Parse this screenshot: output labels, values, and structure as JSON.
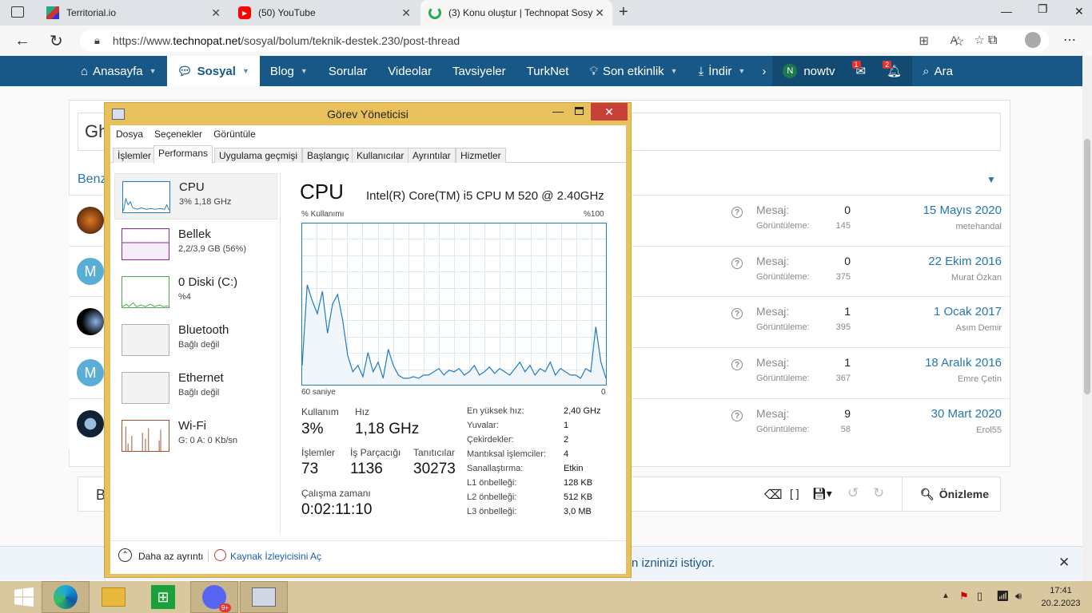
{
  "browser": {
    "tabs": [
      {
        "title": "Territorial.io"
      },
      {
        "title": "(50) YouTube"
      },
      {
        "title": "(3) Konu oluştur | Technopat Sosy"
      }
    ],
    "url_prefix": "https://www.",
    "url_domain": "technopat.net",
    "url_path": "/sosyal/bolum/teknik-destek.230/post-thread"
  },
  "nav": {
    "items": [
      {
        "label": "Anasayfa"
      },
      {
        "label": "Sosyal"
      },
      {
        "label": "Blog"
      },
      {
        "label": "Sorular"
      },
      {
        "label": "Videolar"
      },
      {
        "label": "Tavsiyeler"
      },
      {
        "label": "TurkNet"
      },
      {
        "label": "Son etkinlik"
      },
      {
        "label": "İndir"
      }
    ],
    "user": "nowtv",
    "user_initial": "N",
    "msg_badge": "1",
    "alert_badge": "2",
    "search": "Ara"
  },
  "page": {
    "title_fragment": "Gh",
    "similar_fragment": "Benz",
    "editor_fragment": "B",
    "preview_label": "Önizleme",
    "notice_text": "n izninizi istiyor.",
    "threads": [
      {
        "avatar": "",
        "mesaj_label": "Mesaj:",
        "goruntuleme_label": "Görüntüleme:",
        "mesaj": "0",
        "goruntuleme": "145",
        "date": "15 Mayıs 2020",
        "user": "metehandal"
      },
      {
        "avatar": "M",
        "mesaj_label": "Mesaj:",
        "goruntuleme_label": "Görüntüleme:",
        "mesaj": "0",
        "goruntuleme": "375",
        "date": "22 Ekim 2016",
        "user": "Murat Özkan"
      },
      {
        "avatar": "",
        "mesaj_label": "Mesaj:",
        "goruntuleme_label": "Görüntüleme:",
        "mesaj": "1",
        "goruntuleme": "395",
        "date": "1 Ocak 2017",
        "user": "Asım Demir"
      },
      {
        "avatar": "M",
        "mesaj_label": "Mesaj:",
        "goruntuleme_label": "Görüntüleme:",
        "mesaj": "1",
        "goruntuleme": "367",
        "date": "18 Aralık 2016",
        "user": "Emre Çetin"
      },
      {
        "avatar": "",
        "mesaj_label": "Mesaj:",
        "goruntuleme_label": "Görüntüleme:",
        "mesaj": "9",
        "goruntuleme": "58",
        "date": "30 Mart 2020",
        "user": "Erol55"
      }
    ]
  },
  "taskmgr": {
    "title": "Görev Yöneticisi",
    "menu": [
      "Dosya",
      "Seçenekler",
      "Görüntüle"
    ],
    "tabs": [
      "İşlemler",
      "Performans",
      "Uygulama geçmişi",
      "Başlangıç",
      "Kullanıcılar",
      "Ayrıntılar",
      "Hizmetler"
    ],
    "sidebar": [
      {
        "name": "CPU",
        "sub": "3%  1,18 GHz"
      },
      {
        "name": "Bellek",
        "sub": "2,2/3,9 GB (56%)"
      },
      {
        "name": "0 Diski (C:)",
        "sub": "%4"
      },
      {
        "name": "Bluetooth",
        "sub": "Bağlı değil"
      },
      {
        "name": "Ethernet",
        "sub": "Bağlı değil"
      },
      {
        "name": "Wi-Fi",
        "sub": "G: 0  A: 0 Kb/sn"
      }
    ],
    "heading": "CPU",
    "model": "Intel(R) Core(TM) i5 CPU M 520 @ 2.40GHz",
    "graph_label_left": "% Kullanımı",
    "graph_label_right": "%100",
    "graph_bottom_left": "60 saniye",
    "graph_bottom_right": "0",
    "stats": {
      "kullanim_label": "Kullanım",
      "kullanim": "3%",
      "hiz_label": "Hız",
      "hiz": "1,18 GHz",
      "islemler_label": "İşlemler",
      "islemler": "73",
      "parcacik_label": "İş Parçacığı",
      "parcacik": "1136",
      "tanitici_label": "Tanıtıcılar",
      "tanitici": "30273",
      "calisma_label": "Çalışma zamanı",
      "calisma": "0:02:11:10"
    },
    "specs": [
      {
        "k": "En yüksek hız:",
        "v": "2,40 GHz"
      },
      {
        "k": "Yuvalar:",
        "v": "1"
      },
      {
        "k": "Çekirdekler:",
        "v": "2"
      },
      {
        "k": "Mantıksal işlemciler:",
        "v": "4"
      },
      {
        "k": "Sanallaştırma:",
        "v": "Etkin"
      },
      {
        "k": "L1 önbelleği:",
        "v": "128 KB"
      },
      {
        "k": "L2 önbelleği:",
        "v": "512 KB"
      },
      {
        "k": "L3 önbelleği:",
        "v": "3,0 MB"
      }
    ],
    "footer_less": "Daha az ayrıntı",
    "footer_monitor": "Kaynak İzleyicisini Aç",
    "cpu_history": [
      12,
      62,
      52,
      44,
      58,
      32,
      50,
      56,
      40,
      18,
      8,
      12,
      5,
      20,
      8,
      14,
      4,
      22,
      12,
      6,
      4,
      4,
      5,
      4,
      6,
      6,
      8,
      10,
      6,
      9,
      8,
      10,
      6,
      8,
      12,
      6,
      8,
      11,
      7,
      10,
      8,
      6,
      10,
      14,
      8,
      12,
      6,
      10,
      8,
      14,
      6,
      10,
      8,
      6,
      6,
      4,
      10,
      8,
      36,
      14,
      4
    ]
  },
  "taskbar": {
    "discord_badge": "9+",
    "time": "17:41",
    "date": "20.2.2023"
  }
}
